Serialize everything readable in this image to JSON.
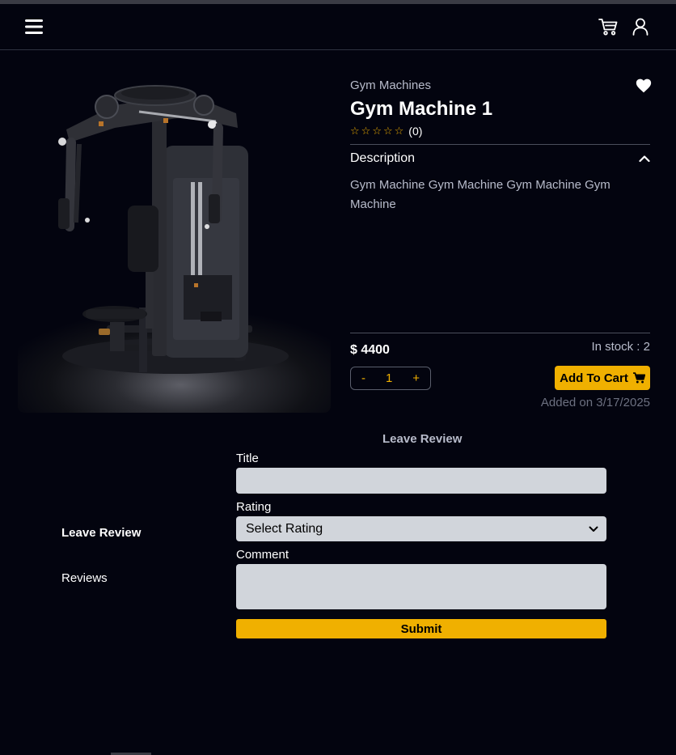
{
  "colors": {
    "background": "#03040f",
    "accent": "#f0b000",
    "muted_text": "#b8bccb",
    "input_bg": "#d1d5db"
  },
  "navbar": {
    "menu_icon": "hamburger-menu-icon",
    "cart_icon": "shopping-cart-icon",
    "user_icon": "user-profile-icon"
  },
  "product": {
    "category": "Gym Machines",
    "title": "Gym Machine 1",
    "rating": 0,
    "rating_count": "(0)",
    "description_label": "Description",
    "description": "Gym Machine Gym Machine Gym Machine Gym Machine",
    "price": "$ 4400",
    "stock": "In stock : 2",
    "quantity": "1",
    "qty_minus": "-",
    "qty_plus": "+",
    "add_to_cart": "Add To Cart",
    "added_on": "Added on 3/17/2025"
  },
  "review_section": {
    "tabs": [
      {
        "label": "Leave Review",
        "active": true
      },
      {
        "label": "Reviews",
        "active": false
      }
    ],
    "heading": "Leave Review",
    "title_label": "Title",
    "title_value": "",
    "rating_label": "Rating",
    "rating_selected": "Select Rating",
    "comment_label": "Comment",
    "comment_value": "",
    "submit_label": "Submit"
  }
}
